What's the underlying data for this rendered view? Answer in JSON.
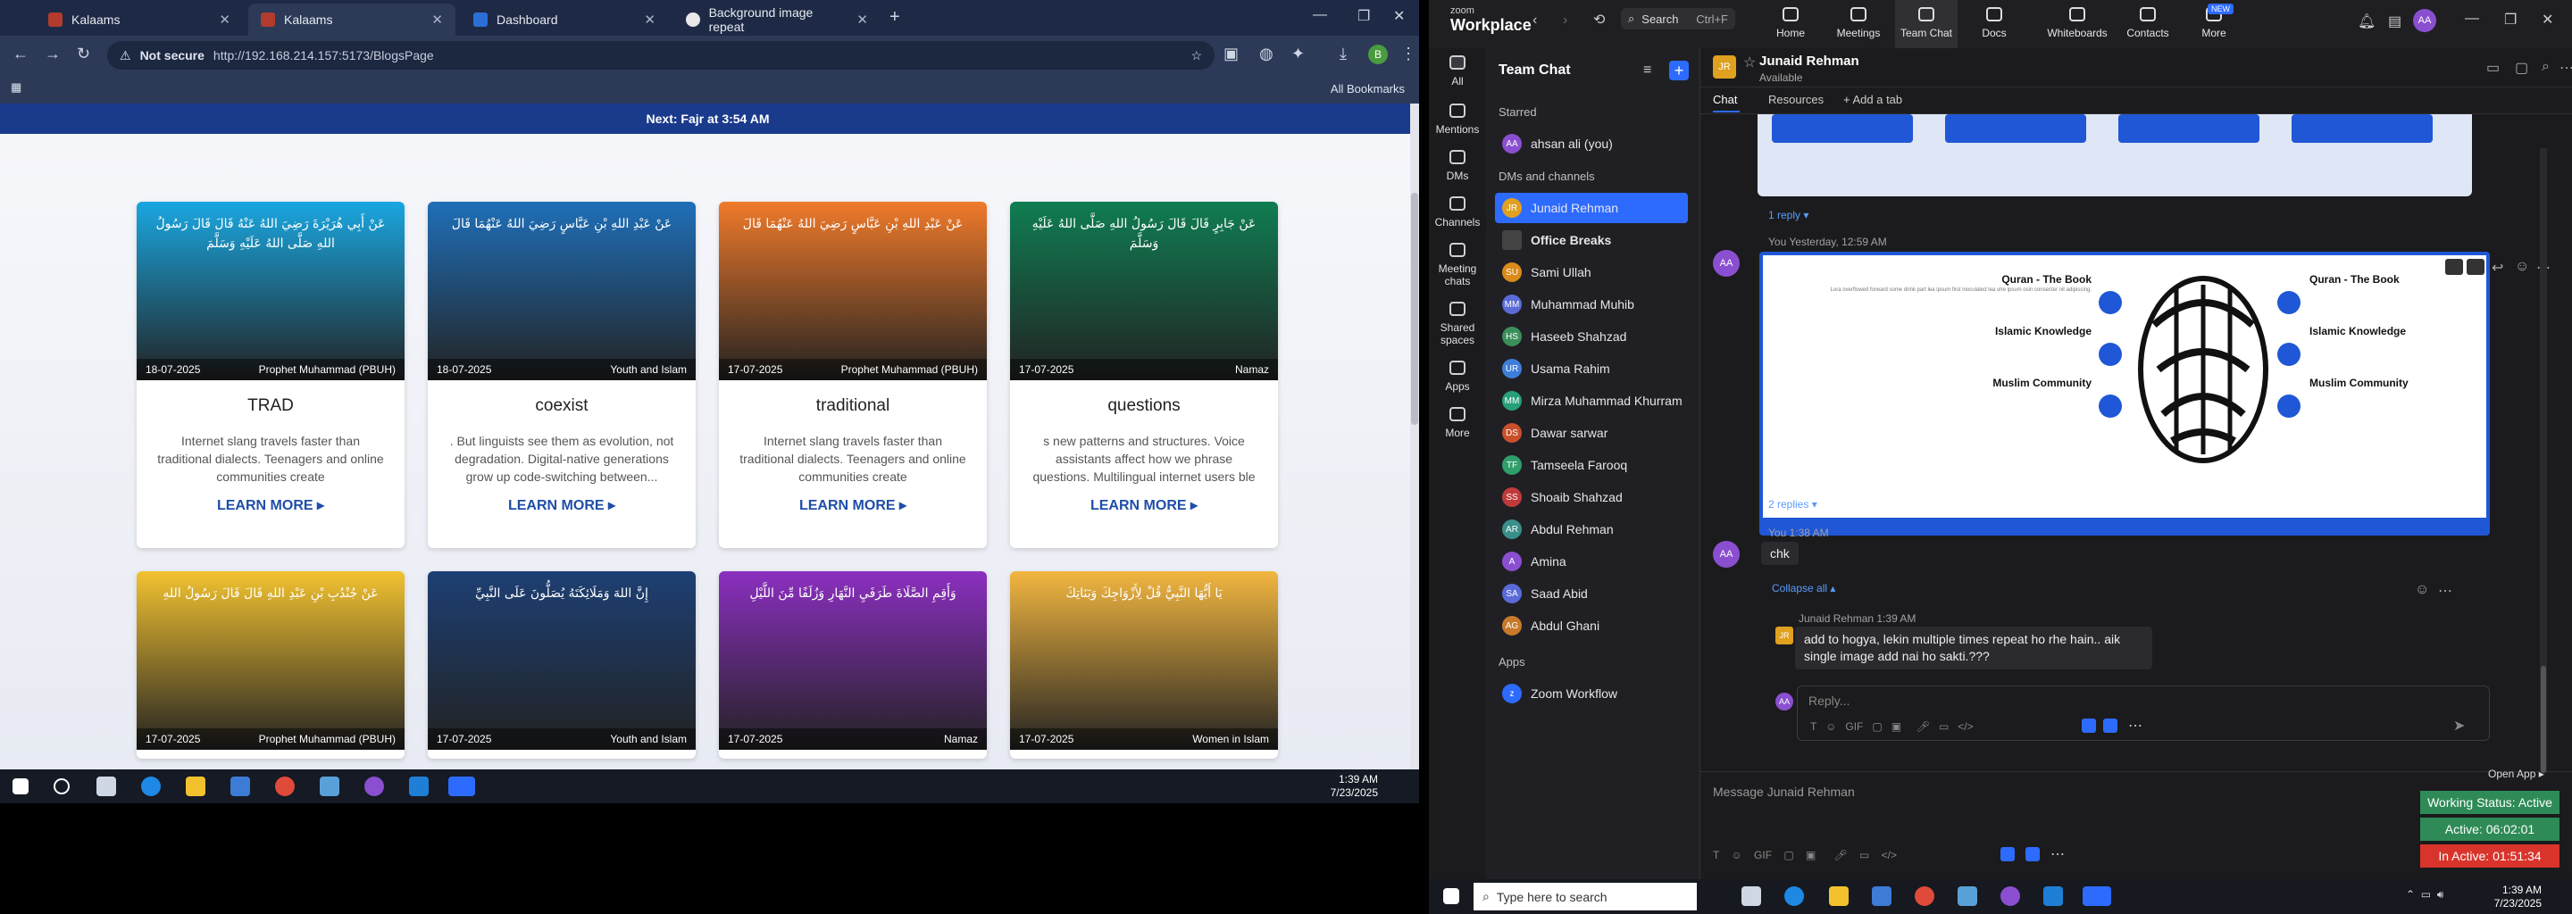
{
  "browser": {
    "tabs": [
      {
        "label": "Kalaams"
      },
      {
        "label": "Kalaams"
      },
      {
        "label": "Dashboard"
      },
      {
        "label": "Background image repeat"
      }
    ],
    "security": "Not secure",
    "url": "http://192.168.214.157:5173/BlogsPage",
    "all_bookmarks": "All Bookmarks",
    "avatar_letter": "B"
  },
  "page": {
    "prayer_bar": "Next: Fajr at 3:54 AM",
    "learn_more": "LEARN MORE ▸",
    "cards": [
      {
        "title": "TRAD",
        "date": "18-07-2025",
        "tag": "Prophet Muhammad (PBUH)",
        "desc": "Internet slang travels faster than traditional dialects. Teenagers and online communities create",
        "arabic": "عَنْ أَبِي هُرَيْرَةَ رَضِيَ اللهُ عَنْهُ قَالَ قَالَ رَسُولُ اللهِ صَلَّى اللهُ عَلَيْهِ وَسَلَّمَ",
        "color": "#1aa7e0"
      },
      {
        "title": "coexist",
        "date": "18-07-2025",
        "tag": "Youth and Islam",
        "desc": ". But linguists see them as evolution, not degradation. Digital-native generations grow up code-switching between...",
        "arabic": "عَنْ عَبْدِ اللهِ بْنِ عَبَّاسٍ رَضِيَ اللهُ عَنْهُمَا قَالَ",
        "color": "#1f6fb8"
      },
      {
        "title": "traditional",
        "date": "17-07-2025",
        "tag": "Prophet Muhammad (PBUH)",
        "desc": "Internet slang travels faster than traditional dialects. Teenagers and online communities create",
        "arabic": "عَنْ عَبْدِ اللهِ بْنِ عَبَّاسٍ رَضِيَ اللهُ عَنْهُمَا قَالَ",
        "color": "#f07a2a"
      },
      {
        "title": "questions",
        "date": "17-07-2025",
        "tag": "Namaz",
        "desc": "s new patterns and structures. Voice assistants affect how we phrase questions. Multilingual internet users ble",
        "arabic": "عَنْ جَابِرٍ قَالَ قَالَ رَسُولُ اللهِ صَلَّى اللهُ عَلَيْهِ وَسَلَّمَ",
        "color": "#0f7d52"
      },
      {
        "title": "",
        "date": "17-07-2025",
        "tag": "Prophet Muhammad (PBUH)",
        "desc": "",
        "arabic": "عَنْ جُنْدُبِ بْنِ عَبْدِ اللهِ قَالَ قَالَ رَسُولُ اللهِ",
        "color": "#f2c230"
      },
      {
        "title": "",
        "date": "17-07-2025",
        "tag": "Youth and Islam",
        "desc": "",
        "arabic": "إِنَّ اللهَ وَمَلَائِكَتَهُ يُصَلُّونَ عَلَى النَّبِيِّ",
        "color": "#1d3f73"
      },
      {
        "title": "",
        "date": "17-07-2025",
        "tag": "Namaz",
        "desc": "",
        "arabic": "وَأَقِمِ الصَّلَاةَ طَرَفَيِ النَّهَارِ وَزُلَفًا مِّنَ اللَّيْلِ",
        "color": "#8b2fc0"
      },
      {
        "title": "",
        "date": "17-07-2025",
        "tag": "Women in Islam",
        "desc": "",
        "arabic": "يَا أَيُّهَا النَّبِيُّ قُلْ لِأَزْوَاجِكَ وَبَنَاتِكَ",
        "color": "#f2b640"
      }
    ]
  },
  "taskbar_left": {
    "time": "1:39 AM",
    "date": "7/23/2025"
  },
  "zoom": {
    "logo_top": "zoom",
    "logo_main": "Workplace",
    "search": "Search",
    "search_shortcut": "Ctrl+F",
    "new_badge": "NEW",
    "nav": [
      {
        "label": "Home"
      },
      {
        "label": "Meetings"
      },
      {
        "label": "Team Chat"
      },
      {
        "label": "Docs"
      },
      {
        "label": "Whiteboards"
      },
      {
        "label": "Contacts"
      },
      {
        "label": "More"
      }
    ],
    "profile_initials": "AA",
    "rail": [
      {
        "label": "All"
      },
      {
        "label": "Mentions"
      },
      {
        "label": "DMs"
      },
      {
        "label": "Channels"
      },
      {
        "label": "Meeting chats"
      },
      {
        "label": "Shared spaces"
      },
      {
        "label": "Apps"
      },
      {
        "label": "More"
      }
    ],
    "sidebar": {
      "title": "Team Chat",
      "starred": "Starred",
      "self": "ahsan ali (you)",
      "dms_header": "DMs and channels",
      "apps_header": "Apps",
      "items": [
        {
          "name": "Junaid Rehman",
          "initials": "JR",
          "color": "#e0a020"
        },
        {
          "name": "Office Breaks",
          "initials": "",
          "color": "#444"
        },
        {
          "name": "Sami Ullah",
          "initials": "SU",
          "color": "#d98a1a"
        },
        {
          "name": "Muhammad Muhib",
          "initials": "MM",
          "color": "#5b6bd6"
        },
        {
          "name": "Haseeb Shahzad",
          "initials": "HS",
          "color": "#3b8f5a"
        },
        {
          "name": "Usama Rahim",
          "initials": "UR",
          "color": "#3f7ed8"
        },
        {
          "name": "Mirza Muhammad Khurram",
          "initials": "MM",
          "color": "#27a07a"
        },
        {
          "name": "Dawar sarwar",
          "initials": "DS",
          "color": "#c8502a"
        },
        {
          "name": "Tamseela Farooq",
          "initials": "TF",
          "color": "#2f9e6b"
        },
        {
          "name": "Shoaib Shahzad",
          "initials": "SS",
          "color": "#c03a3a"
        },
        {
          "name": "Abdul Rehman",
          "initials": "AR",
          "color": "#3a8f88"
        },
        {
          "name": "Amina",
          "initials": "A",
          "color": "#8a4fd0"
        },
        {
          "name": "Saad Abid",
          "initials": "SA",
          "color": "#5a6ad8"
        },
        {
          "name": "Abdul Ghani",
          "initials": "AG",
          "color": "#c87a2a"
        }
      ],
      "app_item": "Zoom Workflow"
    },
    "chat": {
      "contact": "Junaid Rehman",
      "contact_status": "Available",
      "tab_chat": "Chat",
      "tab_resources": "Resources",
      "tab_add": "+ Add a tab",
      "reply1": "1 reply ▾",
      "msg1_meta": "You Yesterday, 12:59 AM",
      "image_labels": {
        "quran": "Quran - The Book",
        "islamic": "Islamic Knowledge",
        "muslim": "Muslim Community",
        "lorem": "Lora overflowed forward some drink part lea ipsum first inoculated lea ulre ipsum osin consecter nit adipiscing."
      },
      "replies2": "2 replies ▾",
      "msg2_meta": "You 1:38 AM",
      "msg2_text": "chk",
      "collapse": "Collapse all ▴",
      "reply_sender": "Junaid Rehman 1:39 AM",
      "reply_text": "add to hogya, lekin multiple times repeat ho rhe hain.. aik single image add nai ho sakti.???",
      "reply_placeholder": "Reply...",
      "compose_placeholder": "Message Junaid Rehman",
      "open_app": "Open App ▸"
    },
    "status": [
      {
        "label": "Working Status: Active",
        "color": "#2e8b57"
      },
      {
        "label": "Active: 06:02:01",
        "color": "#2e8b57"
      },
      {
        "label": "In Active: 01:51:34",
        "color": "#d9342b"
      }
    ]
  },
  "taskbar_right": {
    "search": "Type here to search",
    "time": "1:39 AM",
    "date": "7/23/2025"
  }
}
